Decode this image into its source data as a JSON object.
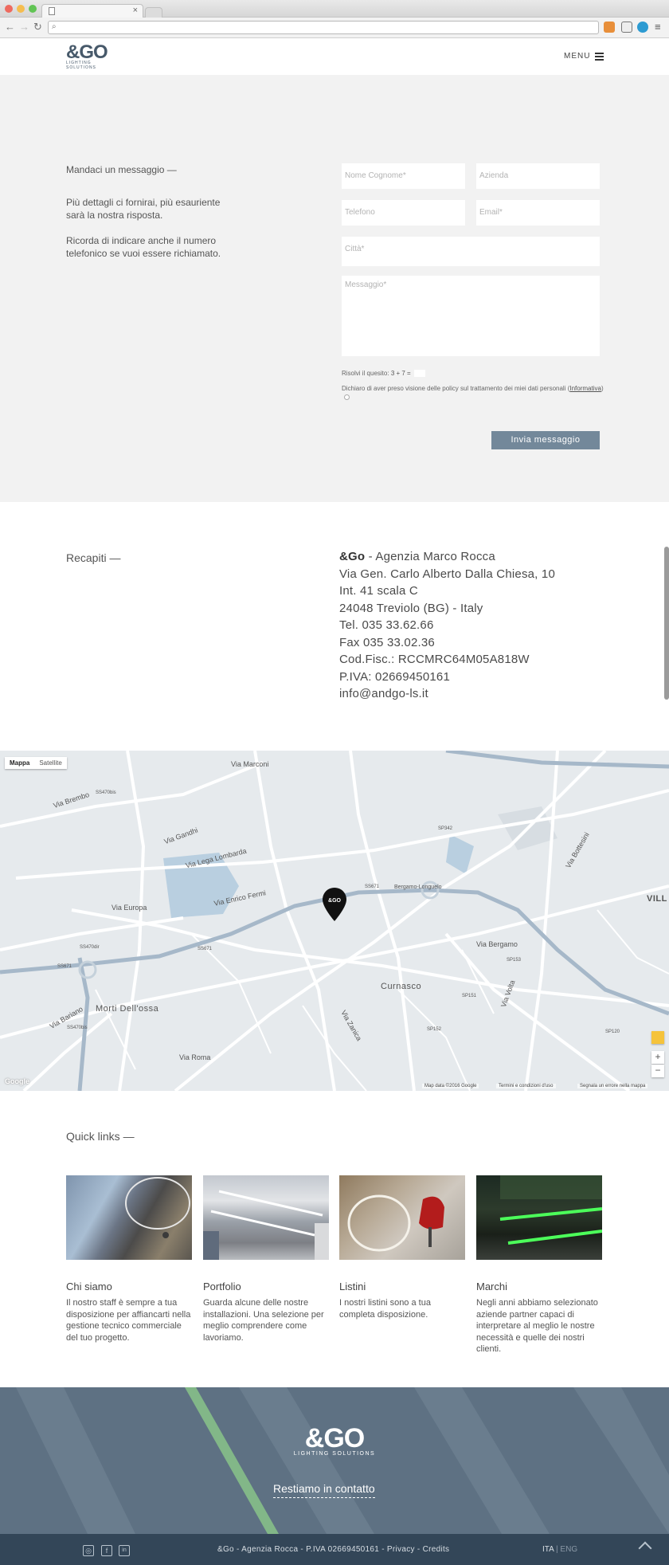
{
  "browser": {
    "tab_close": "×",
    "window_controls": [
      "close",
      "minimize",
      "zoom"
    ],
    "colors": {
      "close": "#ee6a5f",
      "minimize": "#f5bd4f",
      "zoom": "#61c454"
    }
  },
  "header": {
    "logo_main": "&GO",
    "logo_sub": "LIGHTING SOLUTIONS",
    "menu_label": "MENU"
  },
  "form": {
    "title": "Mandaci un messaggio —",
    "intro1": "Più dettagli ci fornirai, più esauriente sarà la nostra risposta.",
    "intro2": "Ricorda di indicare anche il numero telefonico se vuoi essere richiamato.",
    "name_placeholder": "Nome Cognome*",
    "company_placeholder": "Azienda",
    "phone_placeholder": "Telefono",
    "email_placeholder": "Email*",
    "city_placeholder": "Città*",
    "message_placeholder": "Messaggio*",
    "captcha_label": "Risolvi il quesito:",
    "captcha_question": "3 + 7 =",
    "policy_text": "Dichiaro di aver preso visione delle policy sul trattamento dei miei dati personali (",
    "policy_link": "Informativa",
    "policy_end": ")",
    "submit": "Invia messaggio"
  },
  "recapiti": {
    "title": "Recapiti —",
    "brand": "&Go",
    "agency": " - Agenzia Marco Rocca",
    "lines": [
      "Via Gen. Carlo Alberto Dalla Chiesa, 10",
      "Int. 41 scala C",
      "24048 Treviolo (BG) - Italy",
      "Tel. 035 33.62.66",
      "Fax 035 33.02.36",
      "Cod.Fisc.: RCCMRC64M05A818W",
      "P.IVA: 02669450161",
      "info@andgo-ls.it"
    ]
  },
  "map": {
    "type_map": "Mappa",
    "type_satellite": "Satellite",
    "labels": {
      "brembo": "Via Brembo",
      "europa": "Via Europa",
      "gandhi": "Via Gandhi",
      "lega": "Via Lega Lombarda",
      "fermi": "Via Enrico Fermi",
      "morti": "Morti Dell'ossa",
      "curnasco": "Curnasco",
      "bergamo": "Via Bergamo",
      "villa": "VILL",
      "bergamo_longuelo": "Bergamo-Longuelo",
      "marconi": "Via Marconi",
      "roma": "Via Roma",
      "zanica": "Via Zanica",
      "volta": "Via Volta",
      "bariano": "Via Bariano",
      "bottesini": "Via Bottesini",
      "sp_roads": [
        "SS470bis",
        "SS671",
        "SS671",
        "SS671",
        "SS470dir",
        "SP342",
        "SP151",
        "SP153",
        "SP120",
        "SP152",
        "SS470bis"
      ]
    },
    "zoom_in": "+",
    "zoom_out": "−",
    "google": "Google",
    "footer_data": "Map data ©2016 Google",
    "footer_terms": "Termini e condizioni d'uso",
    "footer_report": "Segnala un errore nella mappa",
    "colors": {
      "road": "#ffffff",
      "highway": "#a6b8c9",
      "water": "#b9cfe0",
      "bg": "#e6eaed"
    }
  },
  "quicklinks": {
    "title": "Quick links —",
    "items": [
      {
        "name": "Chi siamo",
        "desc": "Il nostro staff è sempre a tua disposizione per affiancarti nella gestione tecnico commerciale del tuo progetto."
      },
      {
        "name": "Portfolio",
        "desc": "Guarda alcune delle nostre installazioni. Una selezione per meglio comprendere come lavoriamo."
      },
      {
        "name": "Listini",
        "desc": "I nostri listini sono a tua completa disposizione."
      },
      {
        "name": "Marchi",
        "desc": "Negli anni abbiamo selezionato aziende partner capaci di interpretare al meglio le nostre necessità e quelle dei nostri clienti."
      }
    ]
  },
  "footer": {
    "logo_main": "&GO",
    "logo_sub": "LIGHTING SOLUTIONS",
    "contact": "Restiamo in contatto",
    "social_instagram": "◎",
    "social_facebook": "f",
    "social_linkedin": "in",
    "copyline": "&Go - Agenzia Rocca - P.IVA 02669450161 - Privacy - Credits",
    "lang_ita": "ITA",
    "lang_sep": " | ",
    "lang_eng": "ENG"
  }
}
